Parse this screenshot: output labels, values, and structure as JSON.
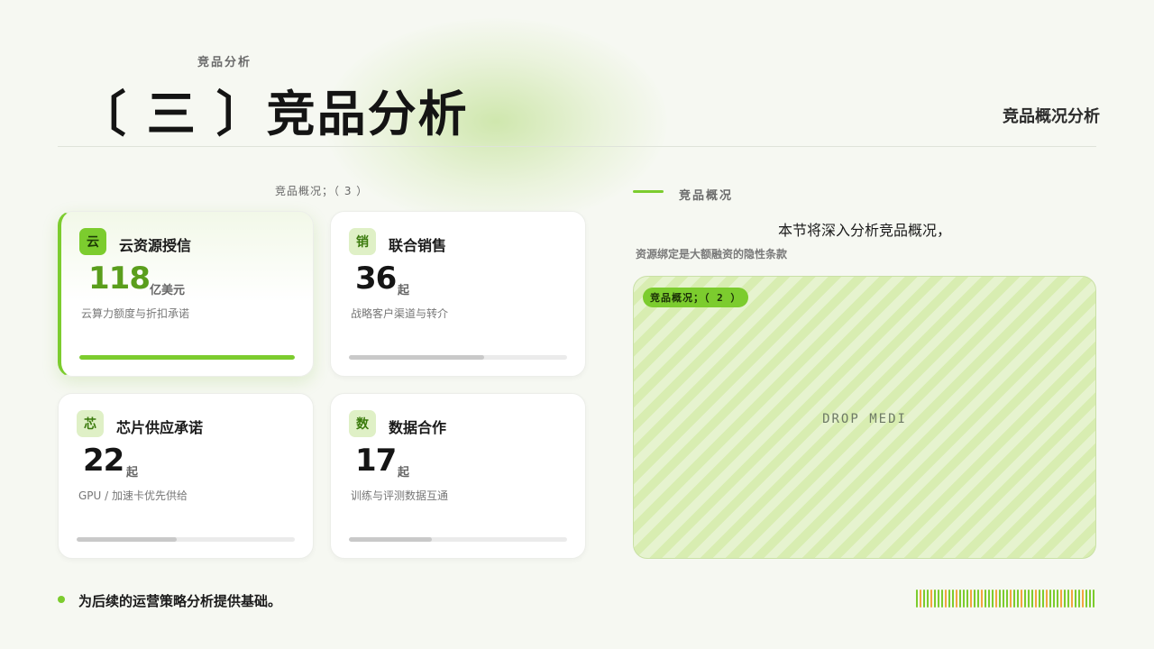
{
  "header": {
    "kicker": "竞品分析",
    "title": "〔 三 〕竞品分析",
    "section": "竞品概况分析"
  },
  "grid": {
    "caption": "竞品概况；（ 3 ）",
    "cards": [
      {
        "icon": "云",
        "icon_name": "cloud-icon",
        "title": "云资源授信",
        "value": "118",
        "unit": "亿美元",
        "desc": "云算力额度与折扣承诺",
        "progress": 1.0,
        "active": true
      },
      {
        "icon": "销",
        "icon_name": "sales-icon",
        "title": "联合销售",
        "value": "36",
        "unit": "起",
        "desc": "战略客户渠道与转介",
        "progress": 0.62,
        "active": false
      },
      {
        "icon": "芯",
        "icon_name": "chip-icon",
        "title": "芯片供应承诺",
        "value": "22",
        "unit": "起",
        "desc": "GPU /  加速卡优先供给",
        "progress": 0.46,
        "active": false
      },
      {
        "icon": "数",
        "icon_name": "data-icon",
        "title": "数据合作",
        "value": "17",
        "unit": "起",
        "desc": "训练与评测数据互通",
        "progress": 0.38,
        "active": false
      }
    ]
  },
  "right": {
    "kicker": "竞品概况",
    "lead": "本节将深入分析竞品概况，",
    "sub": "资源绑定是大额融资的隐性条款",
    "drop_tag": "竞品概况；（ 2 ）",
    "drop_text": "DROP MEDI"
  },
  "footer": {
    "bullet": "为后续的运营策略分析提供基础。"
  },
  "colors": {
    "accent": "#7ccc2e",
    "barcode": [
      "#7ccc2e",
      "#f0a640",
      "#7ccc2e",
      "#7ccc2e",
      "#f0a640",
      "#7ccc2e",
      "#7ccc2e",
      "#7ccc2e",
      "#f0a640",
      "#7ccc2e",
      "#7ccc2e",
      "#f0a640",
      "#7ccc2e",
      "#7ccc2e",
      "#7ccc2e",
      "#f0a640",
      "#7ccc2e",
      "#7ccc2e",
      "#f0a640",
      "#7ccc2e",
      "#7ccc2e",
      "#7ccc2e",
      "#f0a640",
      "#7ccc2e",
      "#7ccc2e",
      "#7ccc2e",
      "#f0a640",
      "#7ccc2e",
      "#7ccc2e",
      "#f0a640",
      "#7ccc2e",
      "#7ccc2e",
      "#7ccc2e",
      "#f0a640",
      "#7ccc2e",
      "#7ccc2e",
      "#f0a640",
      "#7ccc2e",
      "#7ccc2e",
      "#7ccc2e",
      "#f0a640",
      "#7ccc2e",
      "#7ccc2e",
      "#f0a640",
      "#7ccc2e",
      "#7ccc2e",
      "#f0a640",
      "#7ccc2e",
      "#7ccc2e",
      "#7ccc2e"
    ]
  }
}
